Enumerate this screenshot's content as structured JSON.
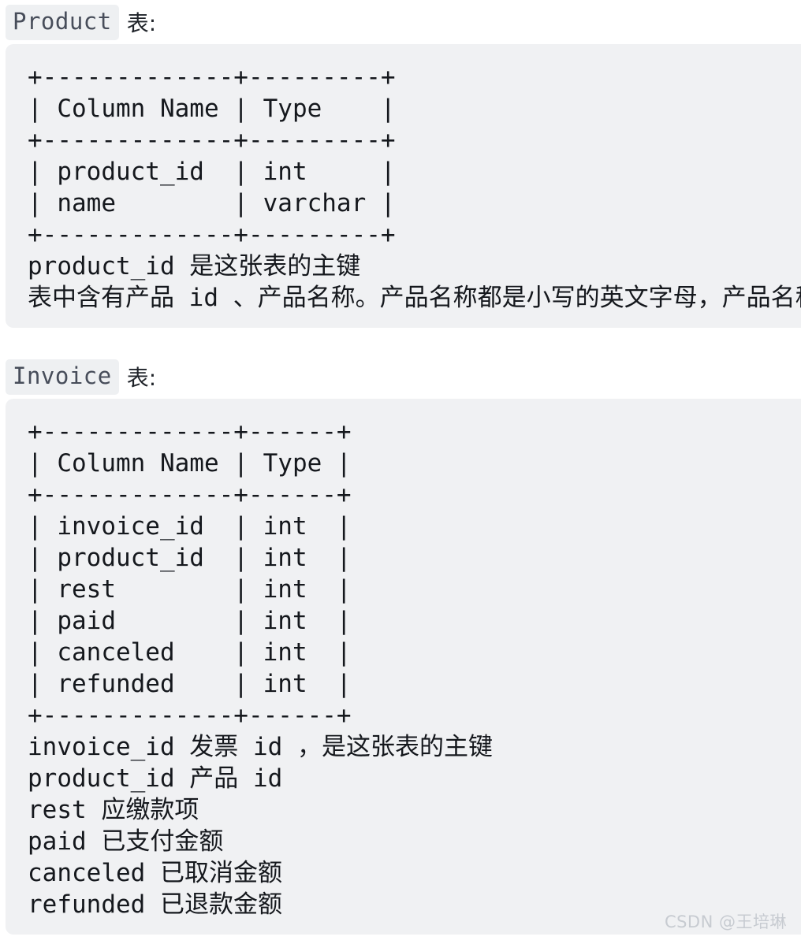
{
  "sections": [
    {
      "heading": {
        "code_label": "Product",
        "suffix": "表:"
      },
      "code_lines": [
        "+-------------+---------+",
        "| Column Name | Type    |",
        "+-------------+---------+",
        "| product_id  | int     |",
        "| name        | varchar |",
        "+-------------+---------+",
        "product_id 是这张表的主键",
        "表中含有产品 id 、产品名称。产品名称都是小写的英文字母，产品名称都是唯一的"
      ]
    },
    {
      "heading": {
        "code_label": "Invoice",
        "suffix": "表:"
      },
      "code_lines": [
        "+-------------+------+",
        "| Column Name | Type |",
        "+-------------+------+",
        "| invoice_id  | int  |",
        "| product_id  | int  |",
        "| rest        | int  |",
        "| paid        | int  |",
        "| canceled    | int  |",
        "| refunded    | int  |",
        "+-------------+------+",
        "invoice_id 发票 id ，是这张表的主键",
        "product_id 产品 id",
        "rest 应缴款项",
        "paid 已支付金额",
        "canceled 已取消金额",
        "refunded 已退款金额"
      ]
    }
  ],
  "watermark": "CSDN @王培琳",
  "colors": {
    "code_background": "#f0f1f3",
    "inline_code_background": "#eef0f2",
    "inline_code_text": "#474d5a",
    "code_text": "#15181d",
    "heading_text": "#1f2329",
    "watermark_text": "#c7cbd1",
    "page_background": "#ffffff"
  }
}
